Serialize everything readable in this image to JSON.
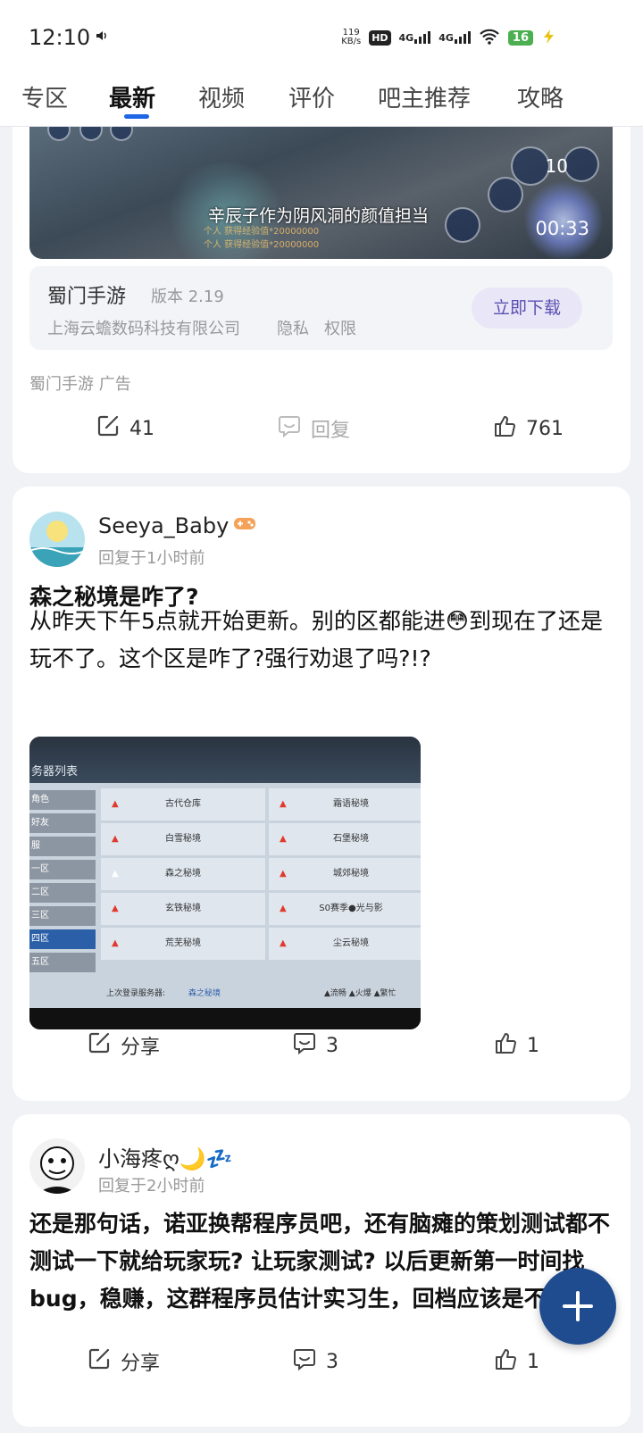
{
  "status_bar": {
    "time": "12:10",
    "net_speed_top": "119",
    "net_speed_bottom": "KB/s",
    "hd": "HD",
    "sig1": "4G",
    "sig2": "4G",
    "battery": "16"
  },
  "tabs": [
    {
      "label": "专区"
    },
    {
      "label": "最新",
      "active": true
    },
    {
      "label": "视频"
    },
    {
      "label": "评价"
    },
    {
      "label": "吧主推荐"
    },
    {
      "label": "攻略"
    }
  ],
  "ad": {
    "video_caption": "辛辰子作为阴风洞的颜值担当",
    "video_sub1": "个人 获得经验值*20000000",
    "video_sub2": "个人 获得经验值*20000000",
    "video_level": "10",
    "video_duration": "00:33",
    "app_name": "蜀门手游",
    "app_version": "版本 2.19",
    "company": "上海云蟾数码科技有限公司",
    "privacy": "隐私",
    "permissions": "权限",
    "download": "立即下载",
    "source_label": "蜀门手游  广告",
    "share_count": "41",
    "reply_label": "回复",
    "like_count": "761"
  },
  "posts": [
    {
      "user": "Seeya_Baby",
      "time": "回复于1小时前",
      "title": "森之秘境是咋了?",
      "body": "从昨天下午5点就开始更新。别的区都能进😳到现在了还是玩不了。这个区是咋了?强行劝退了吗?!?",
      "share": "分享",
      "comments": "3",
      "likes": "1",
      "screenshot": {
        "header": "务器列表",
        "side": [
          "角色",
          "好友",
          "服",
          "一区",
          "二区",
          "三区",
          "四区",
          "五区"
        ],
        "left_col": [
          "古代仓库",
          "白雪秘境",
          "森之秘境",
          "玄铁秘境",
          "荒芜秘境"
        ],
        "right_col": [
          "霜语秘境",
          "石堡秘境",
          "城郊秘境",
          "S0赛季●光与影",
          "尘云秘境"
        ],
        "last_login_label": "上次登录服务器:",
        "last_login_value": "森之秘境",
        "legend": "▲流畅 ▲火爆 ▲繁忙"
      }
    },
    {
      "user": "小海疼ღ🌙💤",
      "time": "回复于2小时前",
      "body": "还是那句话，诺亚换帮程序员吧，还有脑瘫的策划测试都不测试一下就给玩家玩? 让玩家测试? 以后更新第一时间找bug，稳赚，这群程序员估计实习生，回档应该是不会😁",
      "share": "分享",
      "comments": "3",
      "likes": "1"
    }
  ]
}
